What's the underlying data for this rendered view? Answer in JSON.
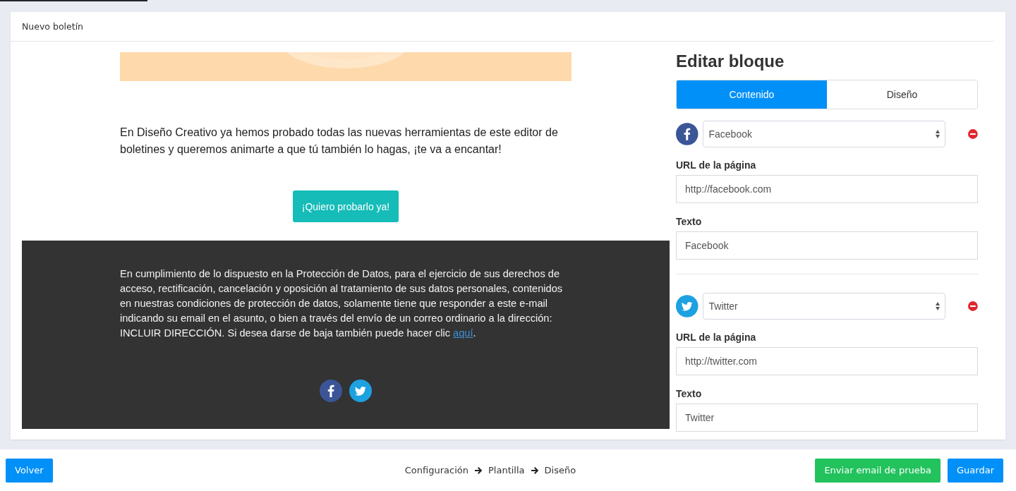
{
  "top_progress": {
    "level": 0.145
  },
  "header": {
    "title": "Nuevo boletín"
  },
  "preview": {
    "intro": "En Diseño Creativo ya hemos probado todas las nuevas herramientas de este editor de boletines y queremos animarte a que tú también lo hagas, ¡te va a encantar!",
    "cta": "¡Quiero probarlo ya!",
    "legal_text": "En cumplimiento de lo dispuesto en la Protección de Datos, para el ejercicio de sus derechos de acceso, rectificación, cancelación y oposición al tratamiento de sus datos personales, contenidos en nuestras condiciones de protección de datos, solamente tiene que responder a este e-mail indicando su email en el asunto, o bien a través del envío de un correo ordinario a la dirección: INCLUIR DIRECCIÓN. Si desea darse de baja también puede hacer clic ",
    "legal_link": "aquí",
    "legal_end": ".",
    "social_icons": [
      {
        "kind": "facebook"
      },
      {
        "kind": "twitter"
      }
    ]
  },
  "editor": {
    "title": "Editar bloque",
    "tabs": [
      {
        "label": "Contenido",
        "selected": true
      },
      {
        "label": "Diseño",
        "selected": false
      }
    ],
    "networks": [
      {
        "kind": "facebook",
        "network": "Facebook",
        "url_label": "URL de la página",
        "url": "http://facebook.com",
        "text_label": "Texto",
        "text": "Facebook"
      },
      {
        "kind": "twitter",
        "network": "Twitter",
        "url_label": "URL de la página",
        "url": "http://twitter.com",
        "text_label": "Texto",
        "text": "Twitter"
      }
    ]
  },
  "footer": {
    "back": "Volver",
    "steps": [
      "Configuración",
      "Plantilla",
      "Diseño"
    ],
    "test": "Enviar email de prueba",
    "save": "Guardar"
  }
}
